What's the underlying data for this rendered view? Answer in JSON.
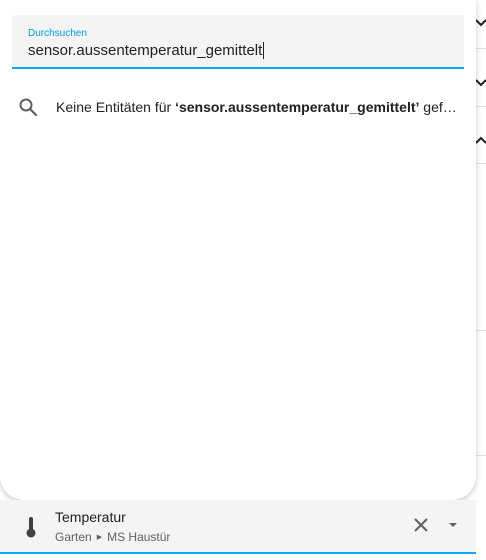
{
  "search": {
    "label": "Durchsuchen",
    "value": "sensor.aussentemperatur_gemittelt"
  },
  "results": {
    "no_results_prefix": "Keine Entitäten für ",
    "no_results_query": "‘sensor.aussentemperatur_gemittelt’",
    "no_results_suffix": " gefunden"
  },
  "entity": {
    "name": "Temperatur",
    "area": "Garten",
    "device": "MS Haustür",
    "icon": "thermometer-icon"
  },
  "colors": {
    "accent": "#03a9f4",
    "label": "#039be5"
  }
}
